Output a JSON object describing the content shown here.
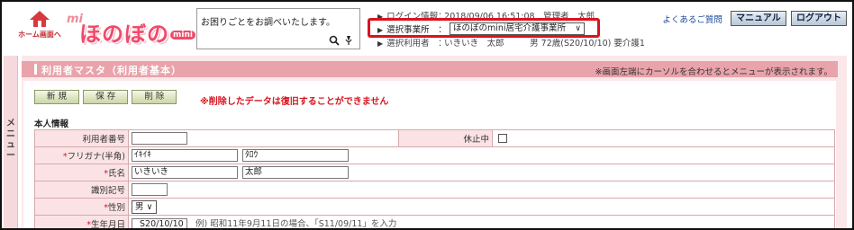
{
  "header": {
    "home_label": "ホーム画面へ",
    "logo_prefix": "mi",
    "logo_text": "ほのぼの",
    "logo_badge": "mini",
    "search_placeholder": "お困りごとをお調べいたします。",
    "info": {
      "login_label": "ログイン情報：",
      "login_value": "2018/09/06 16:51:08　管理者　太郎",
      "office_label": "選択事業所　：",
      "office_value": "ほのぼのmini居宅介護事業所",
      "user_label": "選択利用者　：",
      "user_value": "いきいき　太郎　　　男 72歳(S20/10/10) 要介護1"
    },
    "faq_link": "よくあるご質問",
    "manual_button": "マニュアル",
    "logout_button": "ログアウト"
  },
  "side_menu": {
    "label": "メニュー"
  },
  "page": {
    "title": "利用者マスタ（利用者基本）",
    "hint": "※画面左端にカーソルを合わせるとメニューが表示されます。",
    "buttons": {
      "new": "新 規",
      "save": "保 存",
      "delete": "削 除"
    },
    "warning": "※削除したデータは復旧することができません",
    "section": "本人情報"
  },
  "form": {
    "user_no": {
      "label": "利用者番号",
      "value": ""
    },
    "suspended": {
      "label": "休止中",
      "checked": false
    },
    "kana": {
      "label": "フリガナ(半角)",
      "last": "ｲｷｲｷ",
      "first": "ﾀﾛｳ"
    },
    "name": {
      "label": "氏名",
      "last": "いきいき",
      "first": "太郎"
    },
    "id_code": {
      "label": "識別記号",
      "value": ""
    },
    "gender": {
      "label": "性別",
      "value": "男"
    },
    "birth": {
      "label": "生年月日",
      "value": "S20/10/10",
      "example": "例) 昭和11年9月11日の場合、「S11/09/11」を入力"
    }
  },
  "colors": {
    "accent": "#e9a3ab",
    "required": "#d8141e",
    "highlight_border": "#d8141e"
  }
}
